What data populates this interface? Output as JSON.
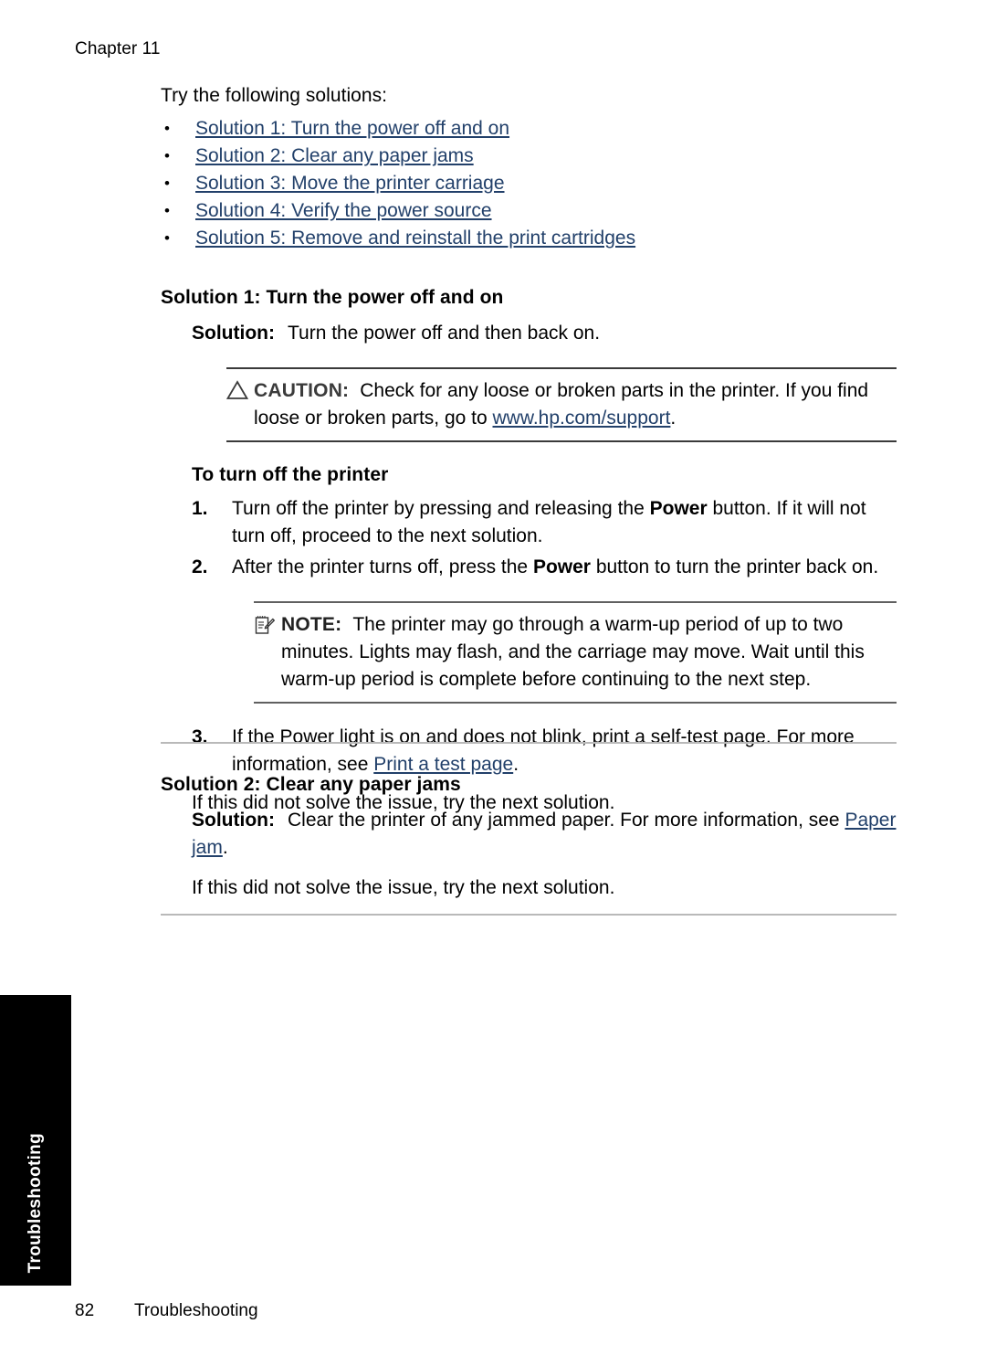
{
  "header": {
    "chapter": "Chapter 11"
  },
  "intro": {
    "lead": "Try the following solutions:",
    "links": [
      "Solution 1: Turn the power off and on",
      "Solution 2: Clear any paper jams",
      "Solution 3: Move the printer carriage",
      "Solution 4: Verify the power source",
      "Solution 5: Remove and reinstall the print cartridges"
    ],
    "bullet_glyph": "•"
  },
  "solution1": {
    "heading": "Solution 1: Turn the power off and on",
    "solution_label": "Solution:",
    "solution_text": "Turn the power off and then back on.",
    "caution": {
      "label": "CAUTION:",
      "text_before_link": "Check for any loose or broken parts in the printer. If you find loose or broken parts, go to ",
      "link": "www.hp.com/support",
      "text_after_link": ".",
      "icon": "warning-triangle-icon"
    },
    "procedure_heading": "To turn off the printer",
    "steps": [
      {
        "num": "1.",
        "parts": [
          {
            "t": "Turn off the printer by pressing and releasing the "
          },
          {
            "t": "Power",
            "b": true
          },
          {
            "t": " button. If it will not turn off, proceed to the next solution."
          }
        ]
      },
      {
        "num": "2.",
        "parts": [
          {
            "t": "After the printer turns off, press the "
          },
          {
            "t": "Power",
            "b": true
          },
          {
            "t": " button to turn the printer back on."
          }
        ]
      }
    ],
    "note": {
      "label": "NOTE:",
      "text": "The printer may go through a warm-up period of up to two minutes. Lights may flash, and the carriage may move. Wait until this warm-up period is complete before continuing to the next step.",
      "icon": "note-pad-pencil-icon"
    },
    "step3": {
      "num": "3.",
      "text_before_link": "If the Power light is on and does not blink, print a self-test page. For more information, see ",
      "link": "Print a test page",
      "text_after_link": "."
    },
    "closing": "If this did not solve the issue, try the next solution."
  },
  "solution2": {
    "heading": "Solution 2: Clear any paper jams",
    "solution_label": "Solution:",
    "text_before_link": "Clear the printer of any jammed paper. For more information, see ",
    "link": "Paper jam",
    "text_after_link": ".",
    "closing": "If this did not solve the issue, try the next solution."
  },
  "side_tab": {
    "label": "Troubleshooting"
  },
  "footer": {
    "page_number": "82",
    "section": "Troubleshooting"
  },
  "colors": {
    "link": "#22406A",
    "divider": "#b9b9b9",
    "rule_dark": "#3a3a3a",
    "tab_background": "#000000",
    "tab_text": "#ffffff",
    "caution_label": "#3b3b3b"
  }
}
